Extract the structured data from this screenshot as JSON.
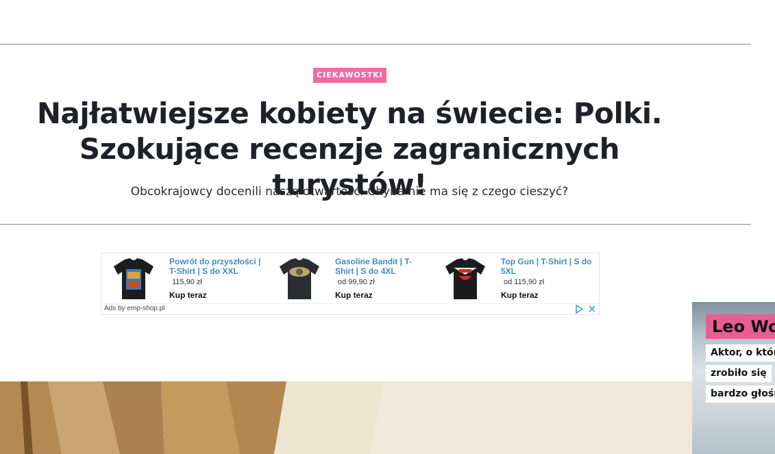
{
  "article": {
    "category": "CIEKAWOSTKI",
    "headline": "Najłatwiejsze kobiety na świecie: Polki. Szokujące recenzje zagranicznych turystów!",
    "lead": "Obcokrajowcy docenili naszą otwartość. Chyba nie ma się z czego cieszyć?"
  },
  "ad": {
    "items": [
      {
        "title": "Powrót do przyszłości | T-Shirt | S do XXL",
        "price": "115,90 zł",
        "buy": "Kup teraz",
        "icon": "tshirt-icon"
      },
      {
        "title": "Gasoline Bandit | T-Shirt | S do 4XL",
        "price": "od 99,90 zł",
        "buy": "Kup teraz",
        "icon": "tshirt-icon"
      },
      {
        "title": "Top Gun | T-Shirt | S do 5XL",
        "price": "od 115,90 zł",
        "buy": "Kup teraz",
        "icon": "tshirt-icon"
      }
    ],
    "by": "Ads by emp-shop.pl",
    "choices_icon": "adchoices-icon",
    "close_icon": "close-icon"
  },
  "side_promo": {
    "name": "Leo Wo",
    "lines": [
      "Aktor, o któr",
      "zrobiło się",
      "bardzo głośn"
    ]
  },
  "colors": {
    "accent": "#f06ba0",
    "promo_pink": "#ea5d90",
    "ad_link": "#3b8bc4"
  }
}
